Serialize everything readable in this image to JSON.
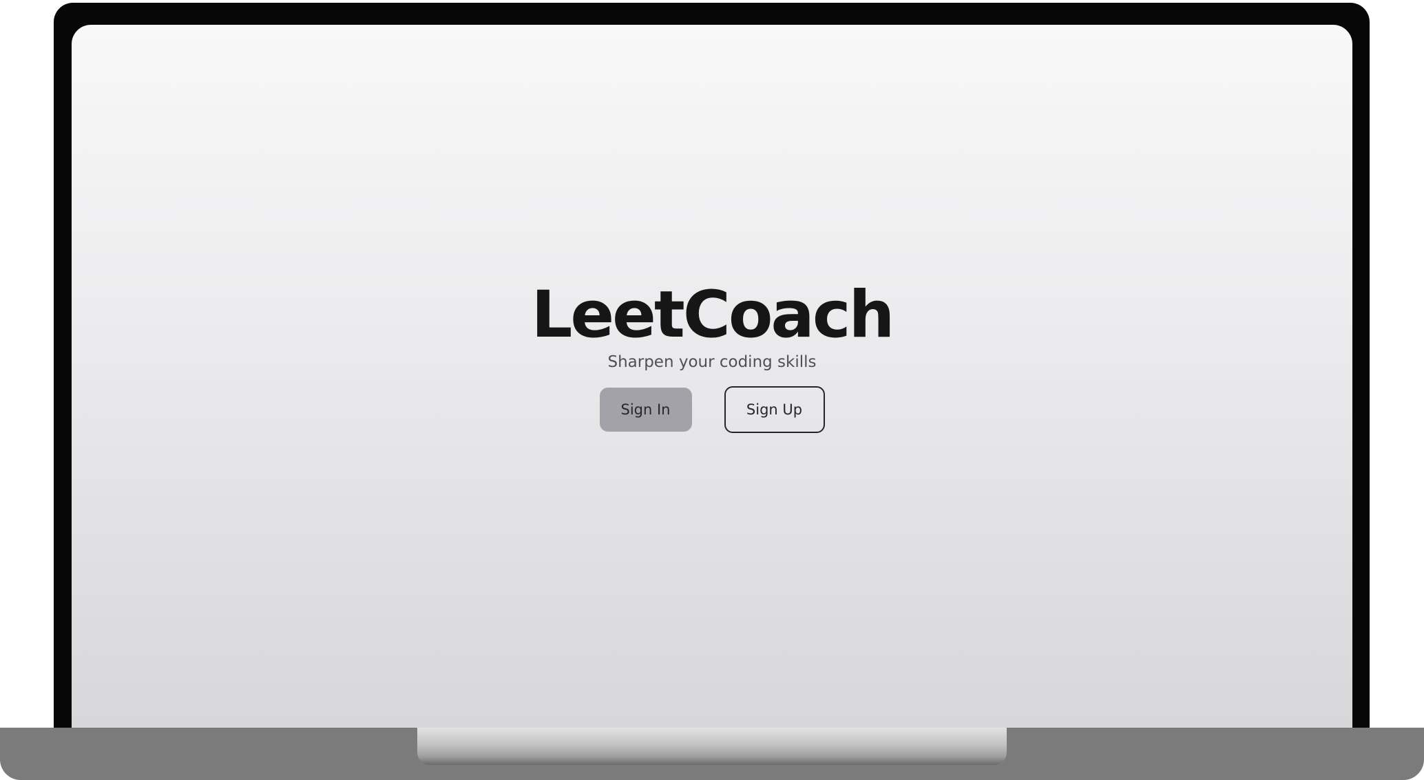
{
  "app": {
    "brand_title": "LeetCoach",
    "tagline": "Sharpen your coding skills"
  },
  "actions": {
    "sign_in_label": "Sign In",
    "sign_up_label": "Sign Up"
  },
  "colors": {
    "title_text": "#161616",
    "tagline_text": "#4f4f57",
    "sign_in_bg": "#a2a2a8",
    "sign_up_border": "#24242a",
    "bezel": "#070707",
    "laptop_base": "#7b7b7b"
  }
}
